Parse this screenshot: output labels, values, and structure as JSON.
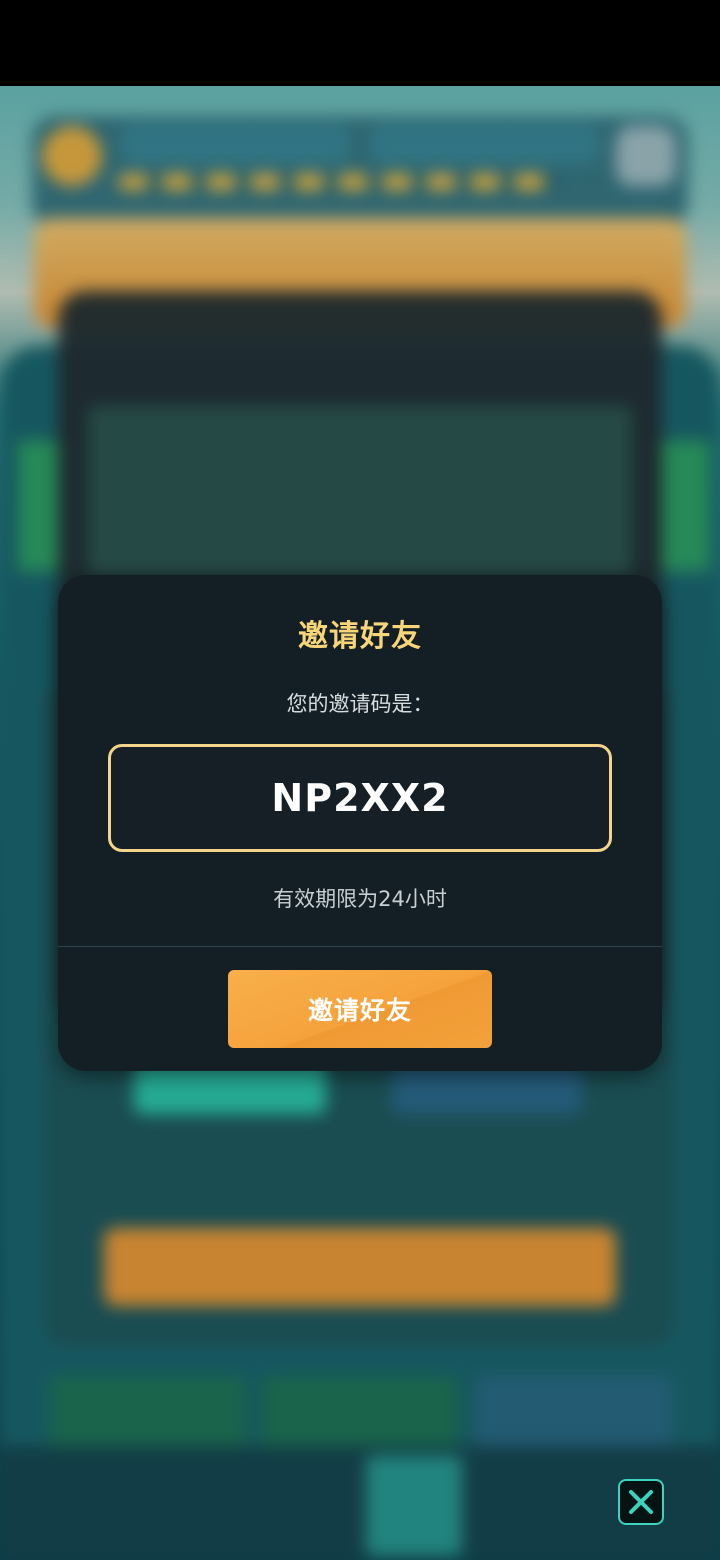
{
  "dialog": {
    "title": "邀请好友",
    "subtitle": "您的邀请码是：",
    "invite_code": "NP2XX2",
    "validity_text": "有效期限为24小时",
    "button_label": "邀请好友"
  },
  "icons": {
    "close": "close-icon"
  },
  "colors": {
    "title": "#f8d579",
    "code_border": "#f3d48a",
    "button": "#f5a23c",
    "dialog_bg": "#131f24",
    "close_accent": "#3ad3bd"
  }
}
